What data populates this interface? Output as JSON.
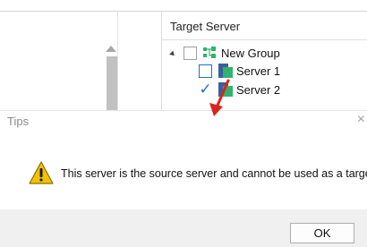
{
  "tree": {
    "header": "Target Server",
    "group": {
      "label": "New Group",
      "checked": false
    },
    "servers": [
      {
        "label": "Server 1",
        "checked": false
      },
      {
        "label": "Server 2",
        "checked": true
      }
    ]
  },
  "dialog": {
    "title": "Tips",
    "close_glyph": "×",
    "message": "This server is the source server and cannot be used as a target!",
    "ok_label": "OK"
  },
  "colors": {
    "accent_blue": "#1e6fc9",
    "annotation_arrow": "#d9261c",
    "warning_yellow": "#f2c200",
    "server_blue": "#3a5f9e",
    "server_green": "#2fb36d"
  }
}
